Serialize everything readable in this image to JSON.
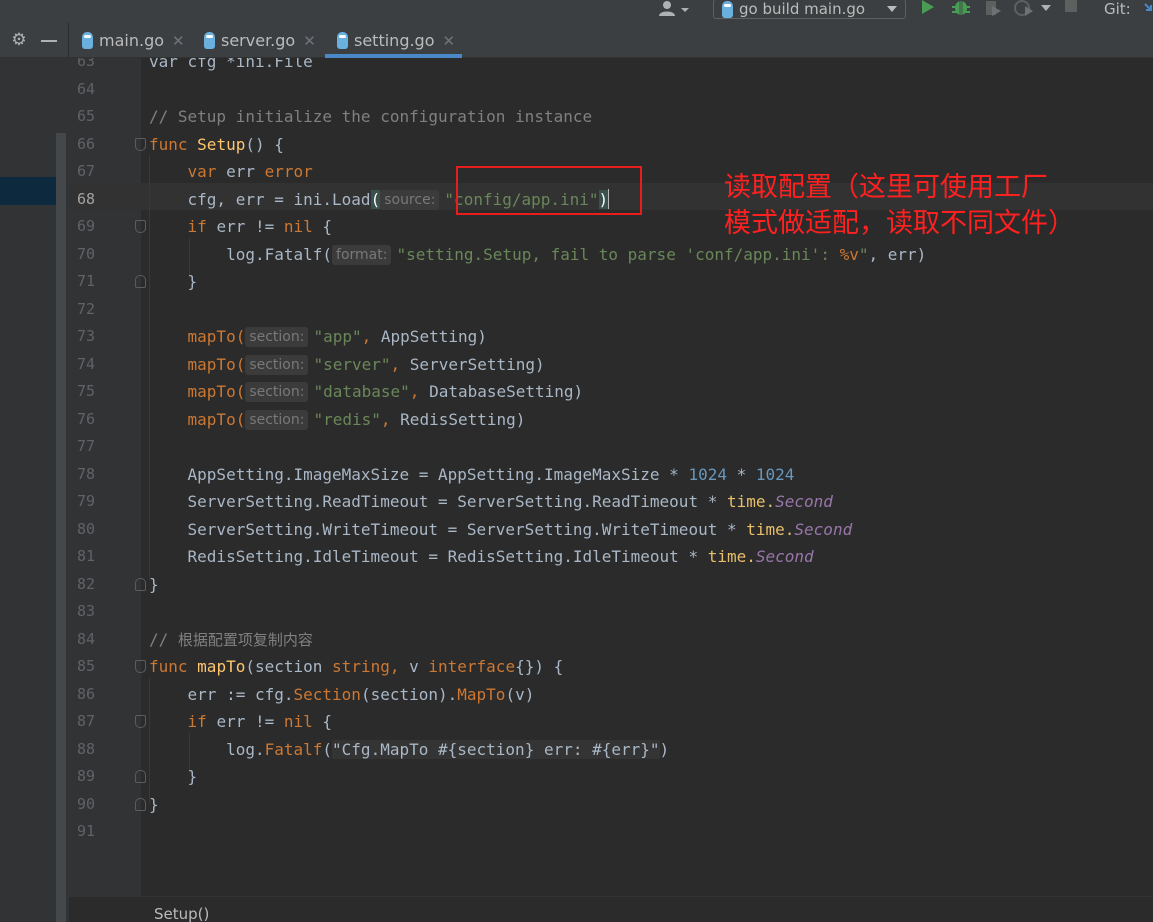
{
  "toolbar": {
    "run_config_label": "go build main.go",
    "git_label": "Git:"
  },
  "tabs": [
    {
      "label": "main.go",
      "active": false
    },
    {
      "label": "server.go",
      "active": false
    },
    {
      "label": "setting.go",
      "active": true
    }
  ],
  "editor": {
    "current_line": 68,
    "lines": [
      {
        "n": "63",
        "parts": [
          {
            "t": "var cfg *ini.File",
            "c": ""
          }
        ]
      },
      {
        "n": "64",
        "parts": []
      },
      {
        "n": "65",
        "parts": [
          {
            "t": "// Setup initialize the configuration instance",
            "c": "cmt"
          }
        ]
      },
      {
        "n": "66",
        "fold": "start",
        "parts": [
          {
            "t": "func ",
            "c": "kw"
          },
          {
            "t": "Setup",
            "c": "fn"
          },
          {
            "t": "() {",
            "c": ""
          }
        ]
      },
      {
        "n": "67",
        "parts": [
          {
            "t": "    ",
            "c": ""
          },
          {
            "t": "var ",
            "c": "kw"
          },
          {
            "t": "err ",
            "c": ""
          },
          {
            "t": "error",
            "c": "kw"
          }
        ]
      },
      {
        "n": "68",
        "parts": [
          {
            "t": "    cfg, err = ini.",
            "c": ""
          },
          {
            "t": "Load",
            "c": ""
          },
          {
            "t": "(",
            "c": "brace-match"
          },
          {
            "t": "source:",
            "c": "hint"
          },
          {
            "t": "\"config/app.ini\"",
            "c": "str"
          },
          {
            "t": ")",
            "c": "brace-match"
          },
          {
            "t": "",
            "c": "caret"
          }
        ]
      },
      {
        "n": "69",
        "fold": "start",
        "parts": [
          {
            "t": "    ",
            "c": ""
          },
          {
            "t": "if ",
            "c": "kw"
          },
          {
            "t": "err != ",
            "c": ""
          },
          {
            "t": "nil",
            "c": "kw"
          },
          {
            "t": " {",
            "c": ""
          }
        ]
      },
      {
        "n": "70",
        "parts": [
          {
            "t": "        log.Fatalf(",
            "c": ""
          },
          {
            "t": "format:",
            "c": "hint"
          },
          {
            "t": "\"setting.Setup, fail to parse 'conf/app.ini': ",
            "c": "str"
          },
          {
            "t": "%v",
            "c": "fmt"
          },
          {
            "t": "\"",
            "c": "str"
          },
          {
            "t": ", err)",
            "c": ""
          }
        ]
      },
      {
        "n": "71",
        "fold": "end",
        "parts": [
          {
            "t": "    }",
            "c": ""
          }
        ]
      },
      {
        "n": "72",
        "parts": []
      },
      {
        "n": "73",
        "parts": [
          {
            "t": "    ",
            "c": ""
          },
          {
            "t": "mapTo(",
            "c": "fmt"
          },
          {
            "t": "section:",
            "c": "hint"
          },
          {
            "t": "\"app\"",
            "c": "str"
          },
          {
            "t": ", ",
            "c": "kw"
          },
          {
            "t": "AppSetting)",
            "c": ""
          }
        ]
      },
      {
        "n": "74",
        "parts": [
          {
            "t": "    ",
            "c": ""
          },
          {
            "t": "mapTo(",
            "c": "fmt"
          },
          {
            "t": "section:",
            "c": "hint"
          },
          {
            "t": "\"server\"",
            "c": "str"
          },
          {
            "t": ", ",
            "c": "kw"
          },
          {
            "t": "ServerSetting)",
            "c": ""
          }
        ]
      },
      {
        "n": "75",
        "parts": [
          {
            "t": "    ",
            "c": ""
          },
          {
            "t": "mapTo(",
            "c": "fmt"
          },
          {
            "t": "section:",
            "c": "hint"
          },
          {
            "t": "\"database\"",
            "c": "str"
          },
          {
            "t": ", ",
            "c": "kw"
          },
          {
            "t": "DatabaseSetting)",
            "c": ""
          }
        ]
      },
      {
        "n": "76",
        "parts": [
          {
            "t": "    ",
            "c": ""
          },
          {
            "t": "mapTo(",
            "c": "fmt"
          },
          {
            "t": "section:",
            "c": "hint"
          },
          {
            "t": "\"redis\"",
            "c": "str"
          },
          {
            "t": ", ",
            "c": "kw"
          },
          {
            "t": "RedisSetting)",
            "c": ""
          }
        ]
      },
      {
        "n": "77",
        "parts": []
      },
      {
        "n": "78",
        "parts": [
          {
            "t": "    AppSetting.ImageMaxSize = AppSetting.ImageMaxSize * ",
            "c": ""
          },
          {
            "t": "1024",
            "c": "num"
          },
          {
            "t": " * ",
            "c": ""
          },
          {
            "t": "1024",
            "c": "num"
          }
        ]
      },
      {
        "n": "79",
        "parts": [
          {
            "t": "    ServerSetting.ReadTimeout = ServerSetting.ReadTimeout * ",
            "c": ""
          },
          {
            "t": "time.",
            "c": "pkg"
          },
          {
            "t": "Second",
            "c": "const"
          }
        ]
      },
      {
        "n": "80",
        "parts": [
          {
            "t": "    ServerSetting.WriteTimeout = ServerSetting.WriteTimeout * ",
            "c": ""
          },
          {
            "t": "time.",
            "c": "pkg"
          },
          {
            "t": "Second",
            "c": "const"
          }
        ]
      },
      {
        "n": "81",
        "parts": [
          {
            "t": "    RedisSetting.IdleTimeout = RedisSetting.IdleTimeout * ",
            "c": ""
          },
          {
            "t": "time.",
            "c": "pkg"
          },
          {
            "t": "Second",
            "c": "const"
          }
        ]
      },
      {
        "n": "82",
        "fold": "end",
        "parts": [
          {
            "t": "}",
            "c": ""
          }
        ]
      },
      {
        "n": "83",
        "parts": []
      },
      {
        "n": "84",
        "parts": [
          {
            "t": "// ",
            "c": "cmt"
          },
          {
            "t": "根据配置项复制内容",
            "c": "cn"
          }
        ]
      },
      {
        "n": "85",
        "fold": "start",
        "parts": [
          {
            "t": "func ",
            "c": "kw"
          },
          {
            "t": "mapTo",
            "c": "fn"
          },
          {
            "t": "(section ",
            "c": ""
          },
          {
            "t": "string",
            "c": "kw"
          },
          {
            "t": ", ",
            "c": "kw"
          },
          {
            "t": "v ",
            "c": ""
          },
          {
            "t": "interface",
            "c": "kw"
          },
          {
            "t": "{}) {",
            "c": ""
          }
        ]
      },
      {
        "n": "86",
        "parts": [
          {
            "t": "    err := cfg.",
            "c": ""
          },
          {
            "t": "Section",
            "c": "fmt"
          },
          {
            "t": "(section).",
            "c": ""
          },
          {
            "t": "MapTo",
            "c": "fmt"
          },
          {
            "t": "(v)",
            "c": ""
          }
        ]
      },
      {
        "n": "87",
        "fold": "start",
        "parts": [
          {
            "t": "    ",
            "c": ""
          },
          {
            "t": "if ",
            "c": "kw"
          },
          {
            "t": "err != ",
            "c": ""
          },
          {
            "t": "nil",
            "c": "kw"
          },
          {
            "t": " {",
            "c": ""
          }
        ]
      },
      {
        "n": "88",
        "parts": [
          {
            "t": "        log.",
            "c": ""
          },
          {
            "t": "Fatalf",
            "c": "fmt"
          },
          {
            "t": "(",
            "c": ""
          },
          {
            "t": "\"Cfg.MapTo #{section} err: #{err}\"",
            "c": "fold-region"
          },
          {
            "t": ")",
            "c": ""
          }
        ]
      },
      {
        "n": "89",
        "fold": "end",
        "parts": [
          {
            "t": "    }",
            "c": ""
          }
        ]
      },
      {
        "n": "90",
        "fold": "end",
        "parts": [
          {
            "t": "}",
            "c": ""
          }
        ]
      },
      {
        "n": "91",
        "parts": []
      }
    ]
  },
  "annotation": {
    "line1": "读取配置（这里可使用工厂",
    "line2": "模式做适配，读取不同文件）",
    "color": "#e81e1e"
  },
  "breadcrumb": {
    "text": "Setup()"
  },
  "colors": {
    "background": "#2b2b2b",
    "gutter": "#313335",
    "tab_underline": "#4a88c7",
    "keyword": "#cc7832",
    "function": "#ffc66d",
    "string": "#6a8759",
    "number": "#6897bb"
  },
  "icons": {
    "user": "user-icon",
    "run": "run-icon",
    "debug": "debug-icon",
    "coverage": "coverage-icon",
    "profile": "profile-icon",
    "stop": "stop-icon",
    "settings": "gear-icon",
    "hide": "minimize-icon",
    "file": "gopher-file-icon"
  }
}
